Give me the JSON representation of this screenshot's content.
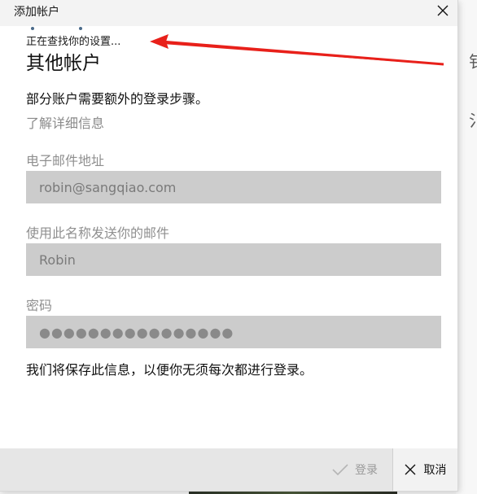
{
  "dialog": {
    "title": "添加帐户",
    "close_icon": "close-icon",
    "status": "正在查找你的设置...",
    "heading": "其他帐户",
    "description": "部分账户需要额外的登录步骤。",
    "learn_more": "了解详细信息",
    "fields": {
      "email": {
        "label": "电子邮件地址",
        "value": "robin@sangqiao.com"
      },
      "display_name": {
        "label": "使用此名称发送你的邮件",
        "value": "Robin"
      },
      "password": {
        "label": "密码",
        "value": "●●●●●●●●●●●●●●●●"
      }
    },
    "save_note": "我们将保存此信息，以便你无须每次都进行登录。"
  },
  "footer": {
    "login_label": "登录",
    "login_icon": "checkmark-icon",
    "cancel_label": "取消",
    "cancel_icon": "close-icon"
  },
  "background": {
    "glyph1": "钅",
    "glyph2": "氵"
  },
  "colors": {
    "annotation_arrow": "#e8201a",
    "input_background": "#cccccc",
    "footer_background": "#e6e6e6"
  }
}
